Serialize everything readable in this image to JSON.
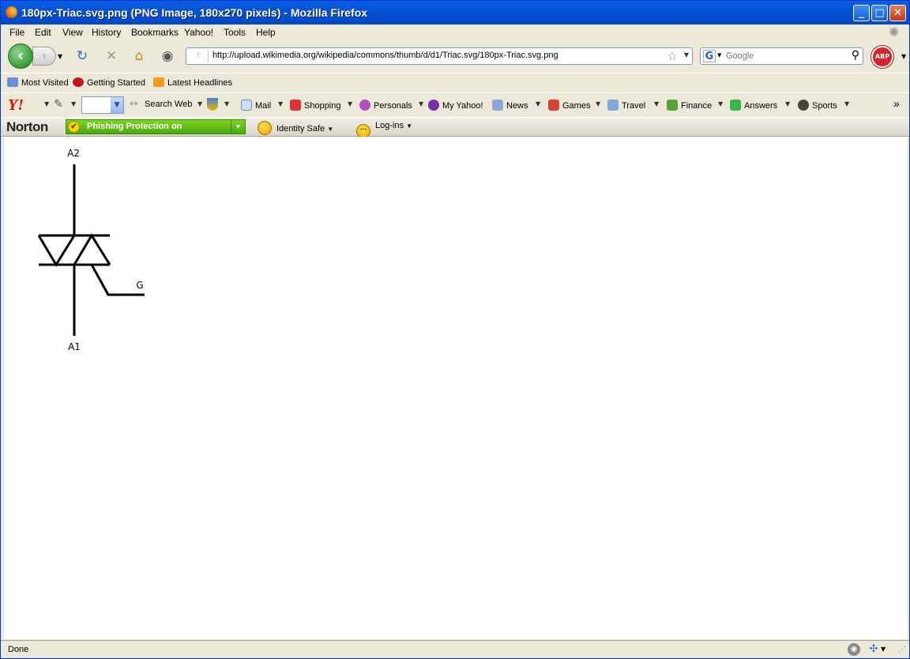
{
  "window": {
    "title": "180px-Triac.svg.png (PNG Image, 180x270 pixels) - Mozilla Firefox",
    "controls": {
      "minimize": "_",
      "maximize": "□",
      "close": "✕"
    }
  },
  "menu": [
    "File",
    "Edit",
    "View",
    "History",
    "Bookmarks",
    "Yahoo!",
    "Tools",
    "Help"
  ],
  "nav": {
    "url": "http://upload.wikimedia.org/wikipedia/commons/thumb/d/d1/Triac.svg/180px-Triac.svg.png",
    "search_engine": "G",
    "search_placeholder": "Google",
    "adblock_label": "ABP"
  },
  "bookmarks": [
    "Most Visited",
    "Getting Started",
    "Latest Headlines"
  ],
  "yahoo_toolbar": {
    "logo": "Y!",
    "search_label": "Search Web",
    "items": [
      "Mail",
      "Shopping",
      "Personals",
      "My Yahoo!",
      "News",
      "Games",
      "Travel",
      "Finance",
      "Answers",
      "Sports"
    ],
    "overflow": "»"
  },
  "norton": {
    "logo": "Norton",
    "phishing": "Phishing Protection on",
    "identity": "Identity Safe",
    "logins": "Log-ins",
    "logins_icon_text": "***"
  },
  "diagram": {
    "labels": {
      "a2": "A2",
      "a1": "A1",
      "g": "G"
    }
  },
  "status": {
    "text": "Done"
  },
  "colors": {
    "titlebar": "#0553D6",
    "chrome": "#ECE9D8",
    "norton_green": "#4BA812",
    "yahoo_red": "#E00000"
  }
}
